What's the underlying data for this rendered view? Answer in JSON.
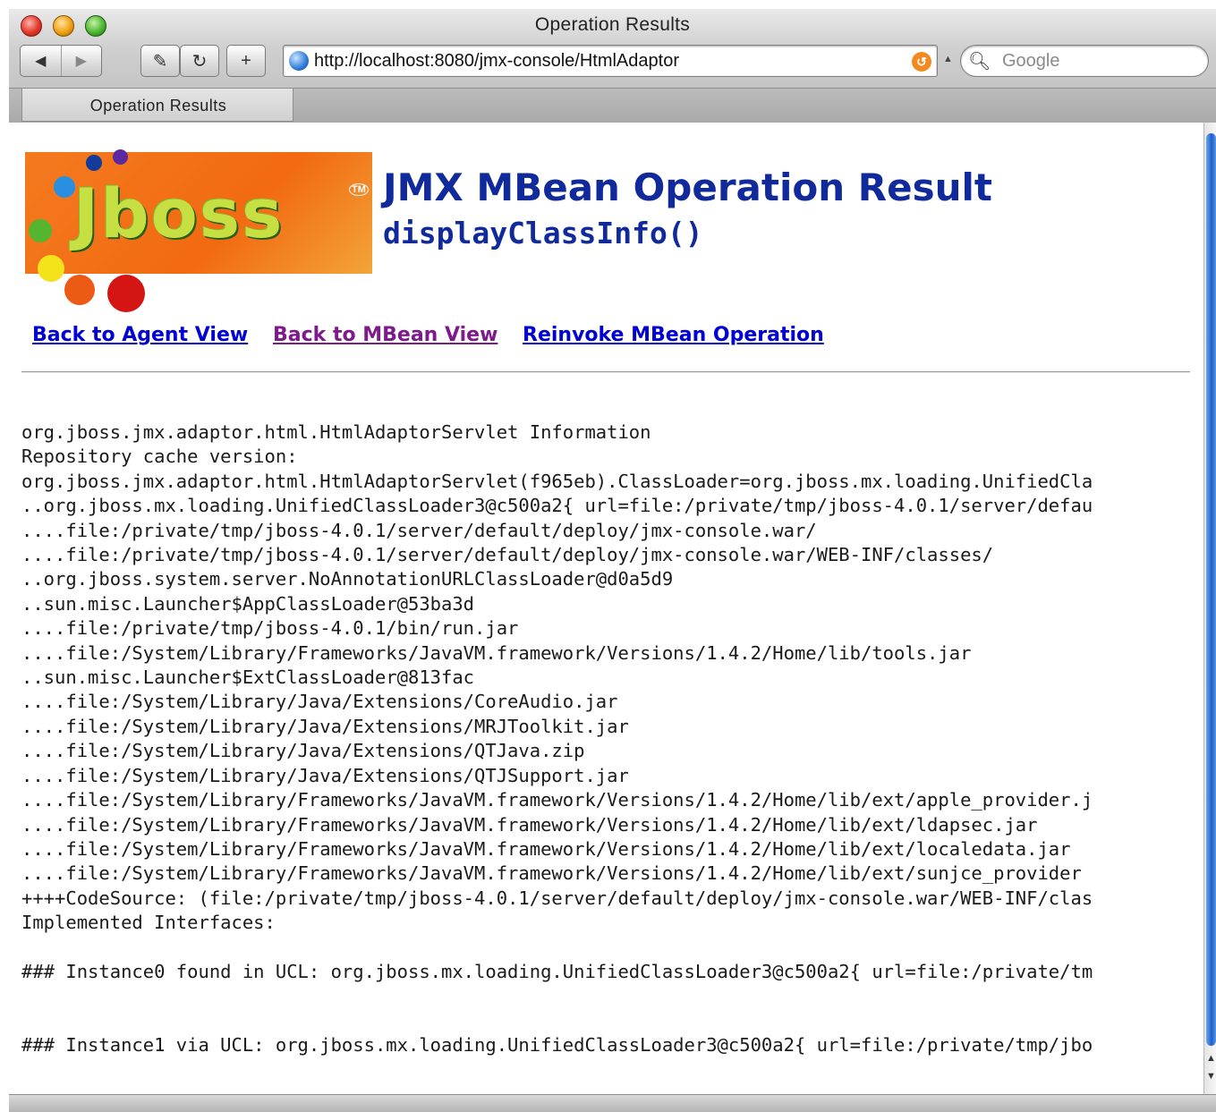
{
  "window": {
    "title": "Operation Results"
  },
  "toolbar": {
    "back_icon": "back-arrow-icon",
    "forward_icon": "forward-arrow-icon",
    "url": "http://localhost:8080/jmx-console/HtmlAdaptor",
    "search_placeholder": "Google"
  },
  "tabs": [
    {
      "label": "Operation Results"
    }
  ],
  "logo": {
    "text": "Jboss",
    "tm": "TM"
  },
  "header": {
    "title": "JMX MBean Operation Result",
    "subtitle": "displayClassInfo()"
  },
  "nav": {
    "agent_view": "Back to Agent View",
    "mbean_view": "Back to MBean View",
    "reinvoke": "Reinvoke MBean Operation"
  },
  "result_lines": [
    "org.jboss.jmx.adaptor.html.HtmlAdaptorServlet Information",
    "Repository cache version:",
    "org.jboss.jmx.adaptor.html.HtmlAdaptorServlet(f965eb).ClassLoader=org.jboss.mx.loading.UnifiedCla",
    "..org.jboss.mx.loading.UnifiedClassLoader3@c500a2{ url=file:/private/tmp/jboss-4.0.1/server/defau",
    "....file:/private/tmp/jboss-4.0.1/server/default/deploy/jmx-console.war/",
    "....file:/private/tmp/jboss-4.0.1/server/default/deploy/jmx-console.war/WEB-INF/classes/",
    "..org.jboss.system.server.NoAnnotationURLClassLoader@d0a5d9",
    "..sun.misc.Launcher$AppClassLoader@53ba3d",
    "....file:/private/tmp/jboss-4.0.1/bin/run.jar",
    "....file:/System/Library/Frameworks/JavaVM.framework/Versions/1.4.2/Home/lib/tools.jar",
    "..sun.misc.Launcher$ExtClassLoader@813fac",
    "....file:/System/Library/Java/Extensions/CoreAudio.jar",
    "....file:/System/Library/Java/Extensions/MRJToolkit.jar",
    "....file:/System/Library/Java/Extensions/QTJava.zip",
    "....file:/System/Library/Java/Extensions/QTJSupport.jar",
    "....file:/System/Library/Frameworks/JavaVM.framework/Versions/1.4.2/Home/lib/ext/apple_provider.j",
    "....file:/System/Library/Frameworks/JavaVM.framework/Versions/1.4.2/Home/lib/ext/ldapsec.jar",
    "....file:/System/Library/Frameworks/JavaVM.framework/Versions/1.4.2/Home/lib/ext/localedata.jar",
    "....file:/System/Library/Frameworks/JavaVM.framework/Versions/1.4.2/Home/lib/ext/sunjce_provider",
    "++++CodeSource: (file:/private/tmp/jboss-4.0.1/server/default/deploy/jmx-console.war/WEB-INF/clas",
    "Implemented Interfaces:",
    "",
    "### Instance0 found in UCL: org.jboss.mx.loading.UnifiedClassLoader3@c500a2{ url=file:/private/tm",
    "",
    "",
    "### Instance1 via UCL: org.jboss.mx.loading.UnifiedClassLoader3@c500a2{ url=file:/private/tmp/jbo"
  ]
}
